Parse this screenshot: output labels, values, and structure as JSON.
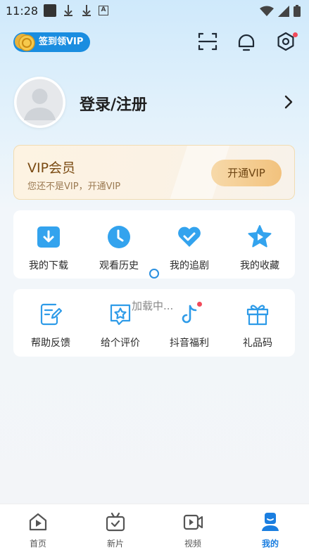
{
  "status_bar": {
    "time": "11:28"
  },
  "header": {
    "signin_vip_label": "签到领VIP"
  },
  "profile": {
    "login_label": "登录/注册"
  },
  "vip_card": {
    "title": "VIP会员",
    "subtitle": "您还不是VIP，开通VIP",
    "button_label": "开通VIP"
  },
  "grid_1": {
    "items": [
      {
        "label": "我的下载",
        "icon": "download-icon"
      },
      {
        "label": "观看历史",
        "icon": "clock-icon"
      },
      {
        "label": "我的追剧",
        "icon": "heart-check-icon"
      },
      {
        "label": "我的收藏",
        "icon": "star-icon"
      }
    ]
  },
  "grid_2": {
    "items": [
      {
        "label": "帮助反馈",
        "icon": "feedback-icon"
      },
      {
        "label": "给个评价",
        "icon": "rate-icon"
      },
      {
        "label": "抖音福利",
        "icon": "tiktok-icon"
      },
      {
        "label": "礼品码",
        "icon": "gift-icon"
      }
    ]
  },
  "loading": {
    "text": "加载中..."
  },
  "bottom_nav": {
    "items": [
      {
        "label": "首页",
        "icon": "home-play-icon"
      },
      {
        "label": "新片",
        "icon": "tv-icon"
      },
      {
        "label": "视频",
        "icon": "video-icon"
      },
      {
        "label": "我的",
        "icon": "profile-icon"
      }
    ],
    "active_index": 3
  },
  "colors": {
    "accent": "#1a8de0",
    "vip_text": "#7a4b13",
    "notification_dot": "#f24a5a"
  }
}
